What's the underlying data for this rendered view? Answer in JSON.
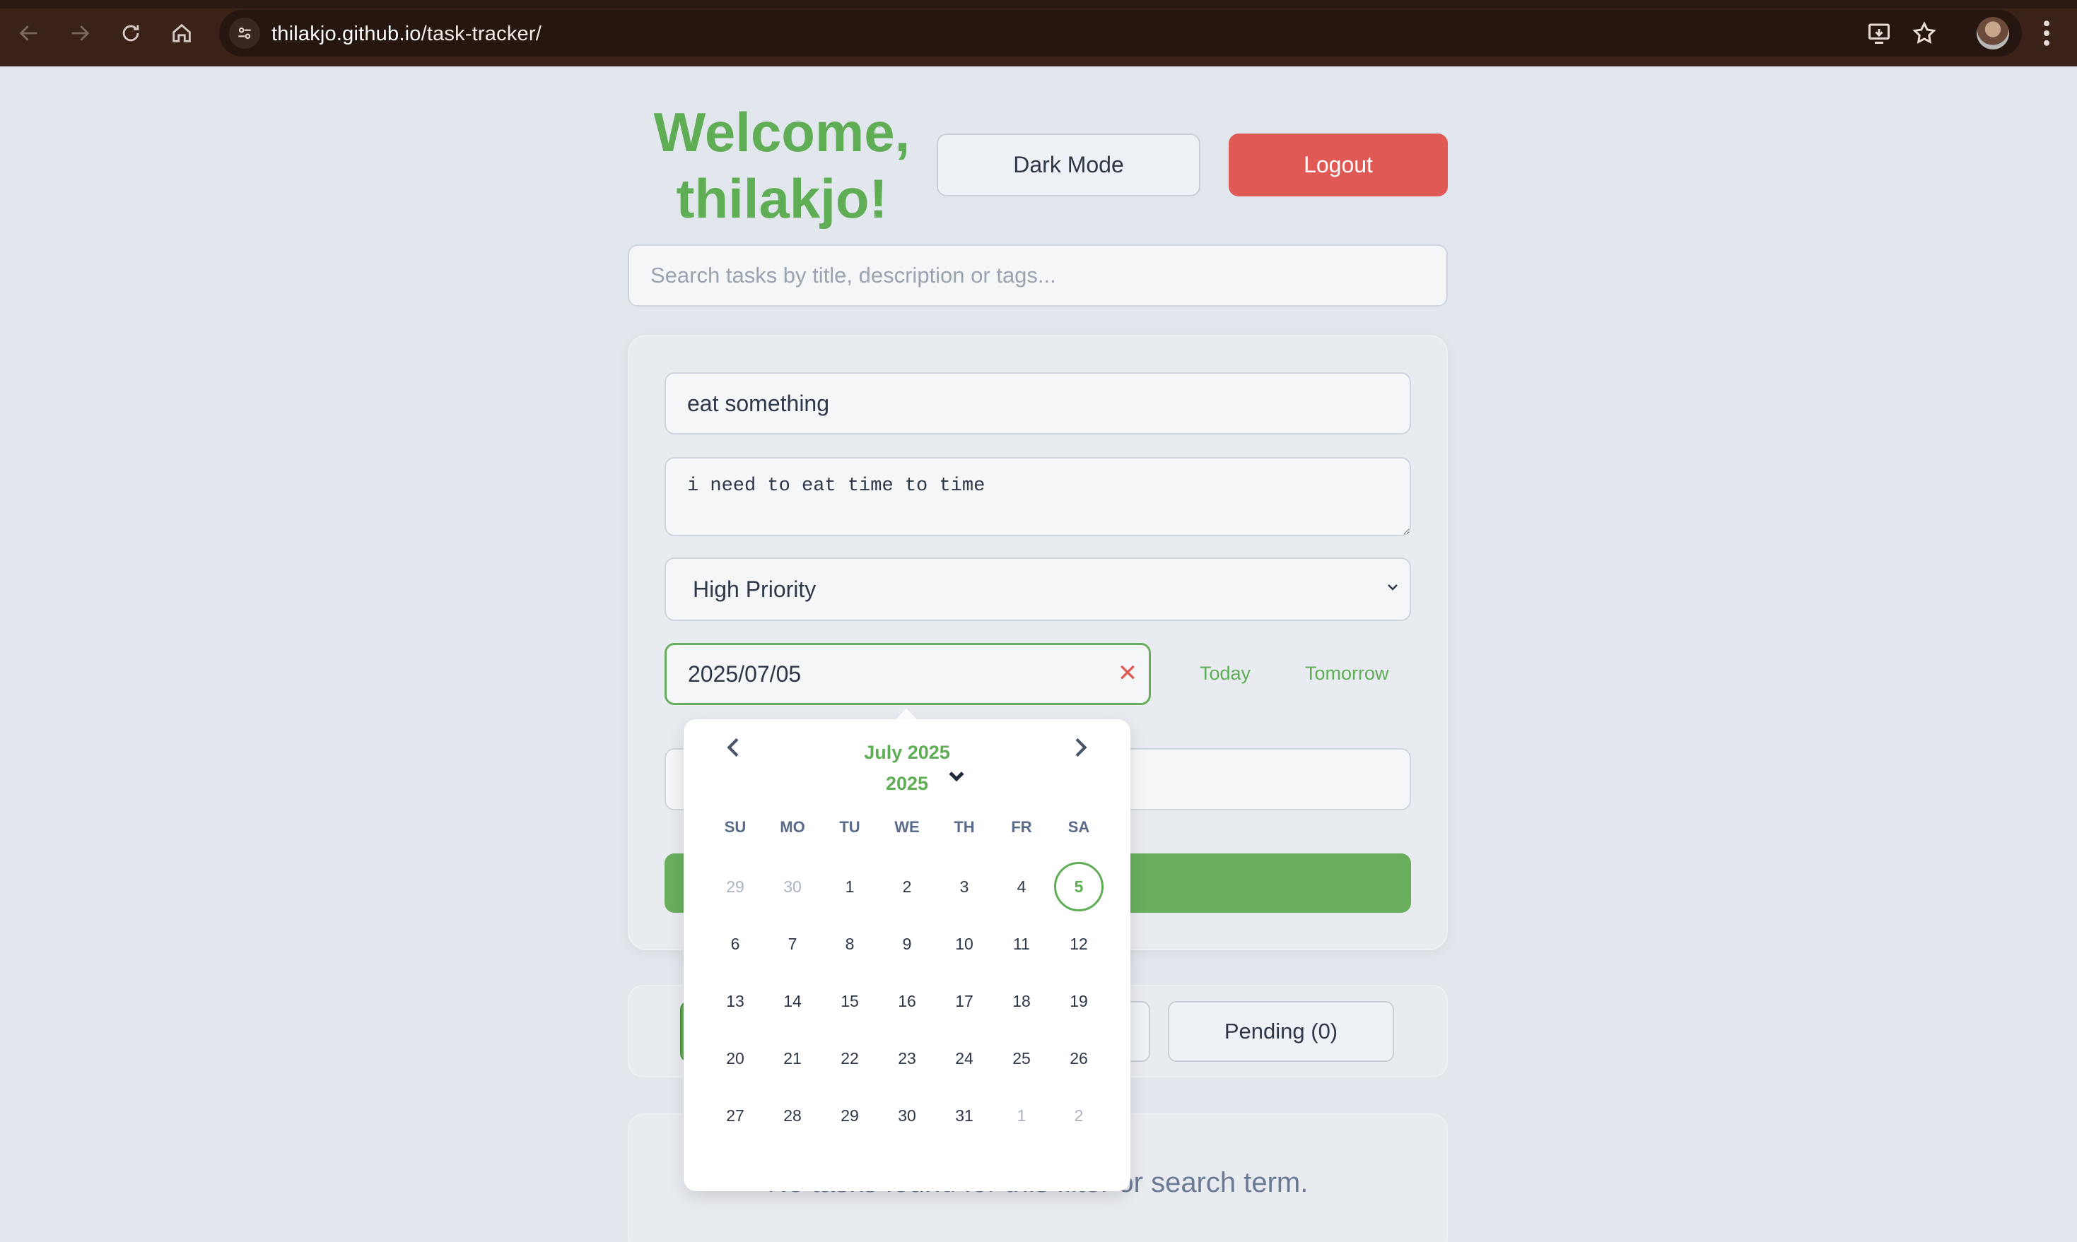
{
  "browser": {
    "url_host": "thilakjo.github.io",
    "url_path": "/task-tracker/"
  },
  "header": {
    "welcome_line1": "Welcome,",
    "welcome_line2": "thilakjo!",
    "dark_mode_label": "Dark Mode",
    "logout_label": "Logout"
  },
  "search": {
    "placeholder": "Search tasks by title, description or tags..."
  },
  "form": {
    "title_value": "eat something",
    "description_value": "i need to eat time to time",
    "priority_selected": "High Priority",
    "due_date_value": "2025/07/05",
    "clear_date_label": "✕",
    "today_label": "Today",
    "tomorrow_label": "Tomorrow"
  },
  "datepicker": {
    "month_label": "July 2025",
    "year_label": "2025",
    "weekdays": [
      "SU",
      "MO",
      "TU",
      "WE",
      "TH",
      "FR",
      "SA"
    ],
    "weeks": [
      [
        "29",
        "30",
        "1",
        "2",
        "3",
        "4",
        "5"
      ],
      [
        "6",
        "7",
        "8",
        "9",
        "10",
        "11",
        "12"
      ],
      [
        "13",
        "14",
        "15",
        "16",
        "17",
        "18",
        "19"
      ],
      [
        "20",
        "21",
        "22",
        "23",
        "24",
        "25",
        "26"
      ],
      [
        "27",
        "28",
        "29",
        "30",
        "31",
        "1",
        "2"
      ]
    ],
    "selected_day": "5"
  },
  "filters": {
    "pending_label": "Pending (0)"
  },
  "task_list": {
    "empty_message": "No tasks found for this filter or search term."
  },
  "colors": {
    "accent_green": "#5fae55",
    "logout_red": "#e05a55",
    "page_bg": "#e2e6ed"
  }
}
